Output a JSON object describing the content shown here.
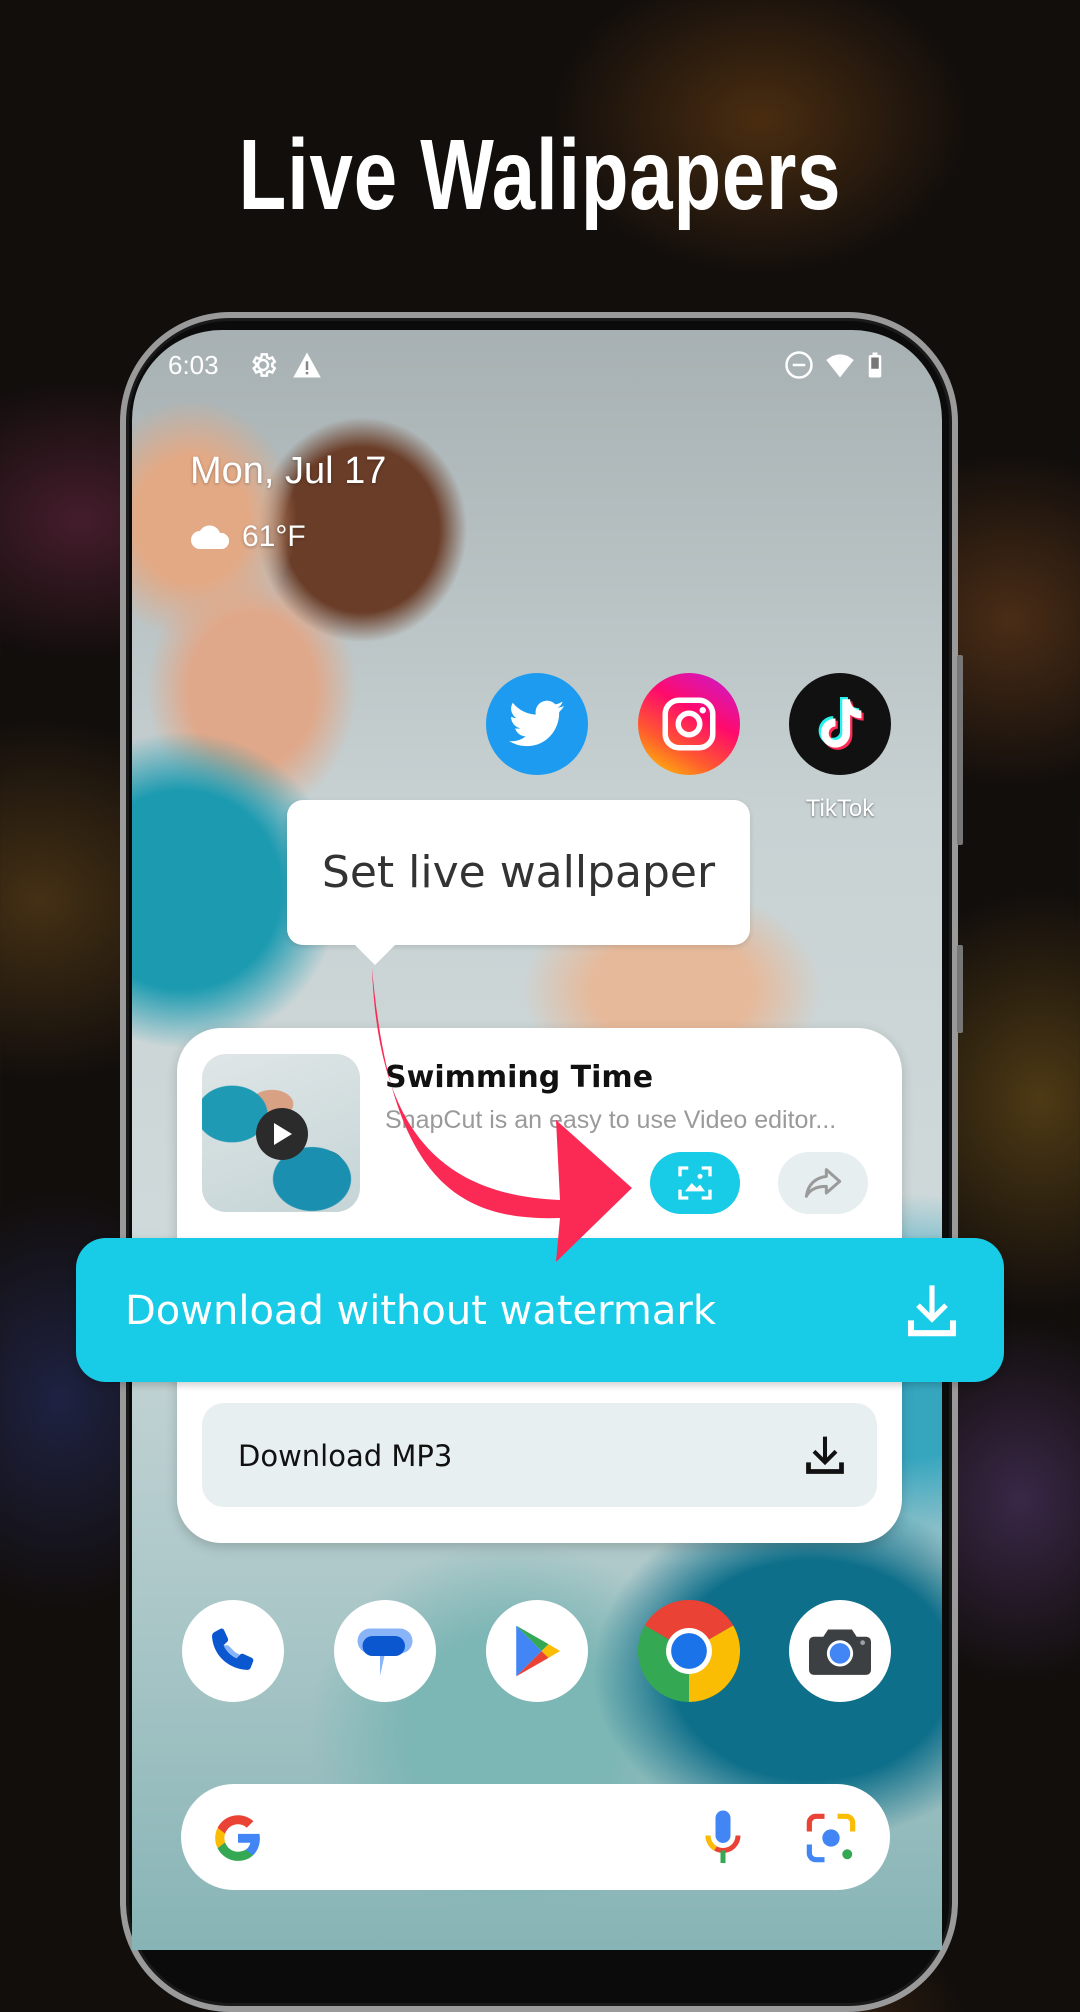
{
  "headline": "Live Walipapers",
  "status_bar": {
    "time": "6:03",
    "left_icons": [
      "settings-icon",
      "warning-icon"
    ],
    "right_icons": [
      "do-not-disturb-icon",
      "wifi-icon",
      "battery-icon"
    ]
  },
  "home": {
    "date": "Mon, Jul 17",
    "weather": {
      "icon": "cloud-icon",
      "temperature": "61°F"
    },
    "apps": [
      {
        "name": "Twitter",
        "label": "",
        "icon": "twitter-icon",
        "color": "#1d9bf0"
      },
      {
        "name": "Instagram",
        "label": "",
        "icon": "instagram-icon",
        "color": "#e1306c"
      },
      {
        "name": "TikTok",
        "label": "TikTok",
        "icon": "tiktok-icon",
        "color": "#111111"
      }
    ],
    "dock": [
      {
        "name": "Phone",
        "icon": "phone-icon"
      },
      {
        "name": "Messages",
        "icon": "messages-icon"
      },
      {
        "name": "Play Store",
        "icon": "play-store-icon"
      },
      {
        "name": "Chrome",
        "icon": "chrome-icon"
      },
      {
        "name": "Camera",
        "icon": "camera-icon"
      }
    ],
    "search": {
      "placeholder": "",
      "icons": [
        "google-g-icon",
        "microphone-icon",
        "lens-icon"
      ]
    }
  },
  "tooltip": {
    "text": "Set live wallpaper"
  },
  "card": {
    "title": "Swimming Time",
    "description": "SnapCut is an easy to use Video editor...",
    "buttons": {
      "wallpaper": "set-wallpaper",
      "share": "share"
    }
  },
  "download_without_watermark": {
    "label": "Download without watermark"
  },
  "download_mp3": {
    "label": "Download MP3"
  },
  "colors": {
    "accent": "#18cbe6",
    "arrow": "#fa2a55",
    "secondary_button": "#e8eff1"
  }
}
